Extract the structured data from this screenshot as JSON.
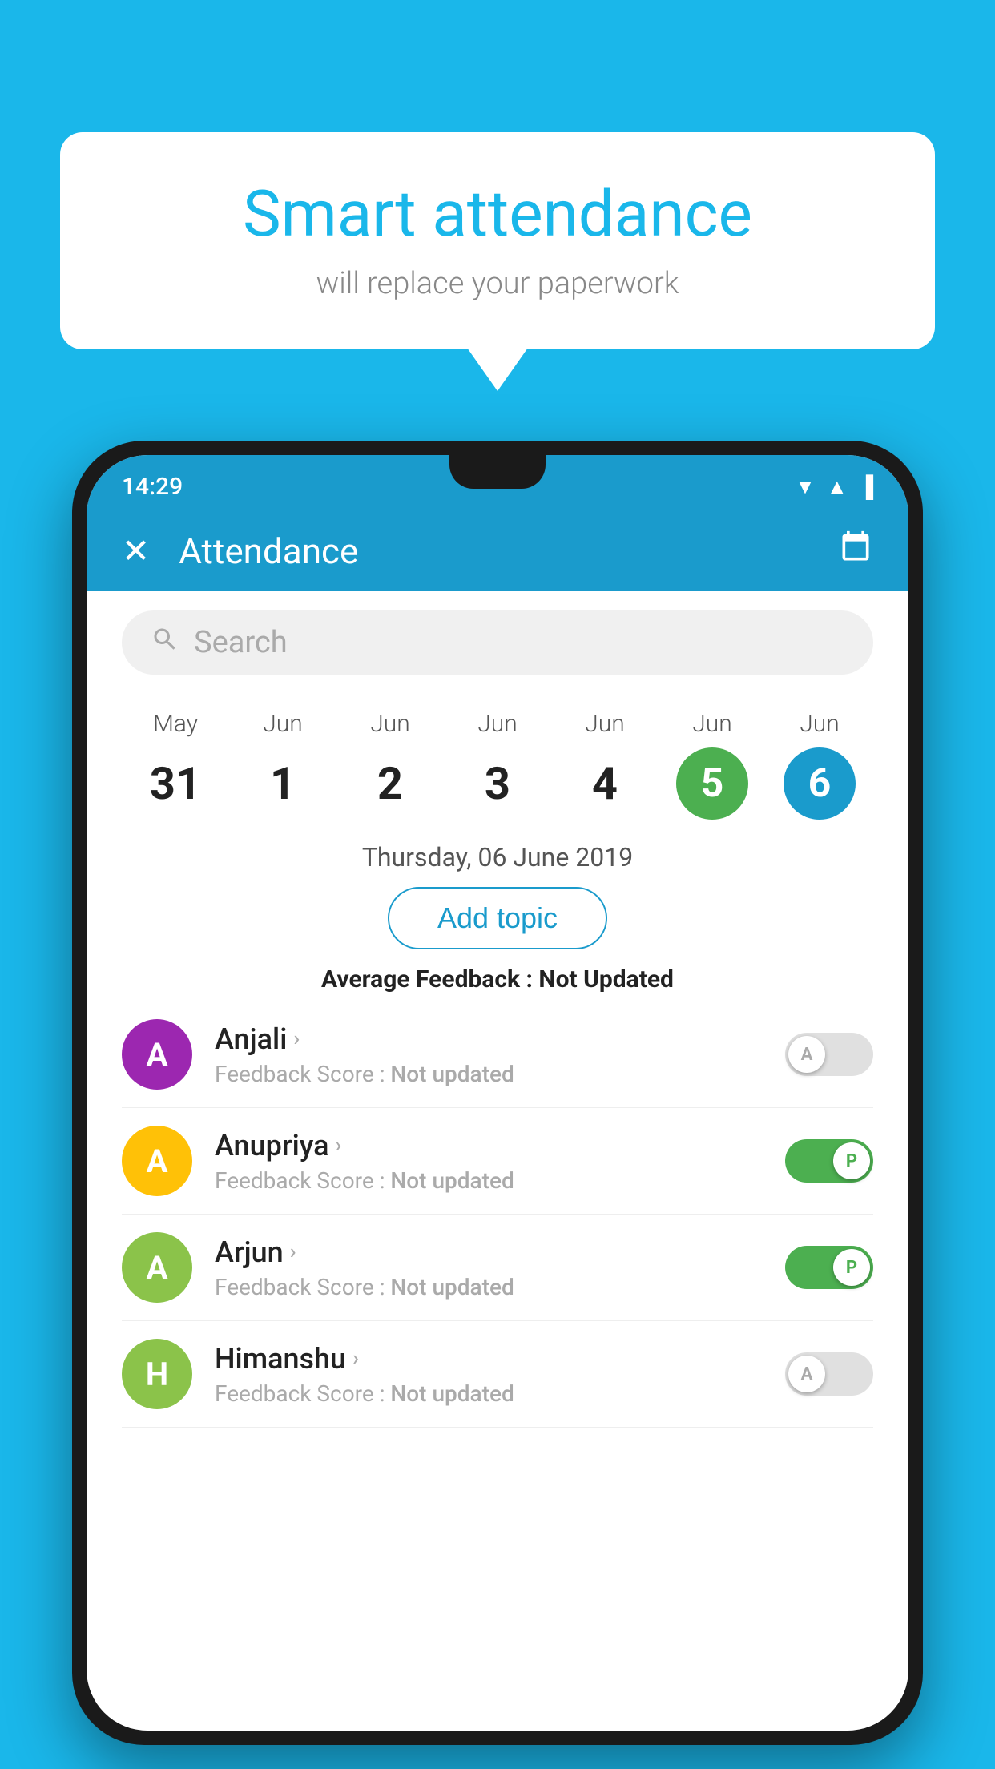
{
  "background_color": "#1ab7ea",
  "speech_bubble": {
    "title": "Smart attendance",
    "subtitle": "will replace your paperwork"
  },
  "status_bar": {
    "time": "14:29",
    "icons": [
      "▼",
      "▲",
      "▐"
    ]
  },
  "app_bar": {
    "title": "Attendance",
    "close_icon": "✕",
    "calendar_icon": "📅"
  },
  "search": {
    "placeholder": "Search"
  },
  "calendar": {
    "days": [
      {
        "month": "May",
        "date": "31",
        "highlight": "none"
      },
      {
        "month": "Jun",
        "date": "1",
        "highlight": "none"
      },
      {
        "month": "Jun",
        "date": "2",
        "highlight": "none"
      },
      {
        "month": "Jun",
        "date": "3",
        "highlight": "none"
      },
      {
        "month": "Jun",
        "date": "4",
        "highlight": "none"
      },
      {
        "month": "Jun",
        "date": "5",
        "highlight": "green"
      },
      {
        "month": "Jun",
        "date": "6",
        "highlight": "blue"
      }
    ]
  },
  "selected_date_label": "Thursday, 06 June 2019",
  "add_topic_label": "Add topic",
  "avg_feedback_label": "Average Feedback : ",
  "avg_feedback_value": "Not Updated",
  "students": [
    {
      "name": "Anjali",
      "avatar_letter": "A",
      "avatar_color": "#9c27b0",
      "feedback_label": "Feedback Score : ",
      "feedback_value": "Not updated",
      "toggle": "off",
      "toggle_label": "A"
    },
    {
      "name": "Anupriya",
      "avatar_letter": "A",
      "avatar_color": "#ffc107",
      "feedback_label": "Feedback Score : ",
      "feedback_value": "Not updated",
      "toggle": "on",
      "toggle_label": "P"
    },
    {
      "name": "Arjun",
      "avatar_letter": "A",
      "avatar_color": "#8bc34a",
      "feedback_label": "Feedback Score : ",
      "feedback_value": "Not updated",
      "toggle": "on",
      "toggle_label": "P"
    },
    {
      "name": "Himanshu",
      "avatar_letter": "H",
      "avatar_color": "#8bc34a",
      "feedback_label": "Feedback Score : ",
      "feedback_value": "Not updated",
      "toggle": "off",
      "toggle_label": "A"
    }
  ]
}
